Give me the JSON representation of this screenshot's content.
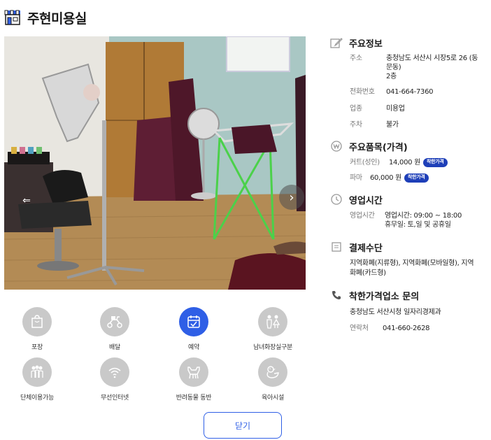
{
  "header": {
    "title": "주현미용실",
    "icon": "storefront-icon"
  },
  "gallery": {
    "prev_icon": "chevron-left-icon",
    "next_icon": "chevron-right-icon"
  },
  "amenities": [
    {
      "label": "포장",
      "icon": "takeout-bag-icon",
      "active": false
    },
    {
      "label": "배달",
      "icon": "delivery-scooter-icon",
      "active": false
    },
    {
      "label": "예약",
      "icon": "calendar-check-icon",
      "active": true
    },
    {
      "label": "남녀화장실구분",
      "icon": "restroom-icon",
      "active": false
    },
    {
      "label": "단체이용가능",
      "icon": "group-icon",
      "active": false
    },
    {
      "label": "무선인터넷",
      "icon": "wifi-icon",
      "active": false
    },
    {
      "label": "반려동물 동반",
      "icon": "pet-dog-icon",
      "active": false
    },
    {
      "label": "육아시설",
      "icon": "duck-icon",
      "active": false
    }
  ],
  "close_label": "닫기",
  "main_info": {
    "title": "주요정보",
    "address_label": "주소",
    "address_line1": "충청남도 서산시 시장5로 26 (동",
    "address_line2": "문동)",
    "address_line3": "2층",
    "phone_label": "전화번호",
    "phone": "041-664-7360",
    "category_label": "업종",
    "category": "미용업",
    "parking_label": "주차",
    "parking": "불가"
  },
  "items": {
    "title": "주요품목(가격)",
    "list": [
      {
        "name": "커트(성인)",
        "price": "14,000 원",
        "badge": "착한가격"
      },
      {
        "name": "파마",
        "price": "60,000 원",
        "badge": "착한가격"
      }
    ]
  },
  "hours": {
    "title": "영업시간",
    "label": "영업시간",
    "time": "영업시간: 09:00 ~ 18:00",
    "holiday": "휴무일: 토,일 및 공휴일"
  },
  "payment": {
    "title": "결제수단",
    "line1": "지역화폐(지류형), 지역화폐(모바일형), 지역",
    "line2": "화폐(카드형)"
  },
  "inquiry": {
    "title": "착한가격업소 문의",
    "office": "충청남도 서산시청 일자리경제과",
    "contact_label": "연락처",
    "contact": "041-660-2628"
  },
  "colors": {
    "accent": "#2f5fe6",
    "badge": "#1e3fb8",
    "icon_inactive": "#c9c9c9"
  }
}
